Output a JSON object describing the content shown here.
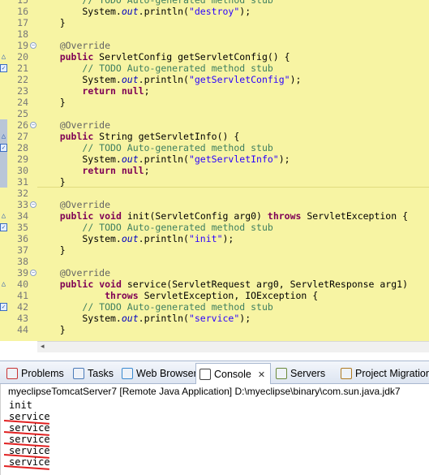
{
  "editor": {
    "lines": [
      {
        "num": "15",
        "tokens": [
          {
            "t": "        ",
            "c": ""
          },
          {
            "t": "// TODO Auto-generated method stub",
            "c": "cm"
          }
        ]
      },
      {
        "num": "16",
        "tokens": [
          {
            "t": "        System.",
            "c": ""
          },
          {
            "t": "out",
            "c": "it"
          },
          {
            "t": ".println(",
            "c": ""
          },
          {
            "t": "\"destroy\"",
            "c": "st"
          },
          {
            "t": ");",
            "c": ""
          }
        ]
      },
      {
        "num": "17",
        "tokens": [
          {
            "t": "    }",
            "c": ""
          }
        ]
      },
      {
        "num": "18",
        "tokens": []
      },
      {
        "num": "19",
        "fold": true,
        "tokens": [
          {
            "t": "    ",
            "c": ""
          },
          {
            "t": "@Override",
            "c": "ann"
          }
        ]
      },
      {
        "num": "20",
        "mark": "ovr",
        "tokens": [
          {
            "t": "    ",
            "c": ""
          },
          {
            "t": "public",
            "c": "kw"
          },
          {
            "t": " ServletConfig getServletConfig() {",
            "c": ""
          }
        ]
      },
      {
        "num": "21",
        "mark": "todo",
        "tokens": [
          {
            "t": "        ",
            "c": ""
          },
          {
            "t": "// TODO Auto-generated method stub",
            "c": "cm"
          }
        ]
      },
      {
        "num": "22",
        "tokens": [
          {
            "t": "        System.",
            "c": ""
          },
          {
            "t": "out",
            "c": "it"
          },
          {
            "t": ".println(",
            "c": ""
          },
          {
            "t": "\"getServletConfig\"",
            "c": "st"
          },
          {
            "t": ");",
            "c": ""
          }
        ]
      },
      {
        "num": "23",
        "tokens": [
          {
            "t": "        ",
            "c": ""
          },
          {
            "t": "return",
            "c": "kw"
          },
          {
            "t": " ",
            "c": ""
          },
          {
            "t": "null",
            "c": "kw"
          },
          {
            "t": ";",
            "c": ""
          }
        ]
      },
      {
        "num": "24",
        "tokens": [
          {
            "t": "    }",
            "c": ""
          }
        ]
      },
      {
        "num": "25",
        "tokens": []
      },
      {
        "num": "26",
        "fold": true,
        "band": true,
        "tokens": [
          {
            "t": "    ",
            "c": ""
          },
          {
            "t": "@Override",
            "c": "ann"
          }
        ]
      },
      {
        "num": "27",
        "mark": "ovr",
        "band": true,
        "tokens": [
          {
            "t": "    ",
            "c": ""
          },
          {
            "t": "public",
            "c": "kw"
          },
          {
            "t": " String getServletInfo() {",
            "c": ""
          }
        ]
      },
      {
        "num": "28",
        "mark": "todo",
        "band": true,
        "tokens": [
          {
            "t": "        ",
            "c": ""
          },
          {
            "t": "// TODO Auto-generated method stub",
            "c": "cm"
          }
        ]
      },
      {
        "num": "29",
        "band": true,
        "tokens": [
          {
            "t": "        System.",
            "c": ""
          },
          {
            "t": "out",
            "c": "it"
          },
          {
            "t": ".println(",
            "c": ""
          },
          {
            "t": "\"getServletInfo\"",
            "c": "st"
          },
          {
            "t": ");",
            "c": ""
          }
        ]
      },
      {
        "num": "30",
        "band": true,
        "tokens": [
          {
            "t": "        ",
            "c": ""
          },
          {
            "t": "return",
            "c": "kw"
          },
          {
            "t": " ",
            "c": ""
          },
          {
            "t": "null",
            "c": "kw"
          },
          {
            "t": ";",
            "c": ""
          }
        ]
      },
      {
        "num": "31",
        "band": true,
        "current": true,
        "tokens": [
          {
            "t": "    }",
            "c": ""
          }
        ]
      },
      {
        "num": "32",
        "tokens": []
      },
      {
        "num": "33",
        "fold": true,
        "tokens": [
          {
            "t": "    ",
            "c": ""
          },
          {
            "t": "@Override",
            "c": "ann"
          }
        ]
      },
      {
        "num": "34",
        "mark": "ovr",
        "tokens": [
          {
            "t": "    ",
            "c": ""
          },
          {
            "t": "public",
            "c": "kw"
          },
          {
            "t": " ",
            "c": ""
          },
          {
            "t": "void",
            "c": "kw"
          },
          {
            "t": " init(ServletConfig arg0) ",
            "c": ""
          },
          {
            "t": "throws",
            "c": "kw"
          },
          {
            "t": " ServletException {",
            "c": ""
          }
        ]
      },
      {
        "num": "35",
        "mark": "todo",
        "tokens": [
          {
            "t": "        ",
            "c": ""
          },
          {
            "t": "// TODO Auto-generated method stub",
            "c": "cm"
          }
        ]
      },
      {
        "num": "36",
        "tokens": [
          {
            "t": "        System.",
            "c": ""
          },
          {
            "t": "out",
            "c": "it"
          },
          {
            "t": ".println(",
            "c": ""
          },
          {
            "t": "\"init\"",
            "c": "st"
          },
          {
            "t": ");",
            "c": ""
          }
        ]
      },
      {
        "num": "37",
        "tokens": [
          {
            "t": "    }",
            "c": ""
          }
        ]
      },
      {
        "num": "38",
        "tokens": []
      },
      {
        "num": "39",
        "fold": true,
        "tokens": [
          {
            "t": "    ",
            "c": ""
          },
          {
            "t": "@Override",
            "c": "ann"
          }
        ]
      },
      {
        "num": "40",
        "mark": "ovr",
        "tokens": [
          {
            "t": "    ",
            "c": ""
          },
          {
            "t": "public",
            "c": "kw"
          },
          {
            "t": " ",
            "c": ""
          },
          {
            "t": "void",
            "c": "kw"
          },
          {
            "t": " service(ServletRequest arg0, ServletResponse arg1)",
            "c": ""
          }
        ]
      },
      {
        "num": "41",
        "tokens": [
          {
            "t": "            ",
            "c": ""
          },
          {
            "t": "throws",
            "c": "kw"
          },
          {
            "t": " ServletException, IOException {",
            "c": ""
          }
        ]
      },
      {
        "num": "42",
        "mark": "todo",
        "tokens": [
          {
            "t": "        ",
            "c": ""
          },
          {
            "t": "// TODO Auto-generated method stub",
            "c": "cm"
          }
        ]
      },
      {
        "num": "43",
        "tokens": [
          {
            "t": "        System.",
            "c": ""
          },
          {
            "t": "out",
            "c": "it"
          },
          {
            "t": ".println(",
            "c": ""
          },
          {
            "t": "\"service\"",
            "c": "st"
          },
          {
            "t": ");",
            "c": ""
          }
        ]
      },
      {
        "num": "44",
        "tokens": [
          {
            "t": "    }",
            "c": ""
          }
        ]
      }
    ]
  },
  "tabs": [
    {
      "label": "Problems",
      "icon": "problems-icon",
      "active": false
    },
    {
      "label": "Tasks",
      "icon": "tasks-icon",
      "active": false
    },
    {
      "label": "Web Browser",
      "icon": "globe-icon",
      "active": false
    },
    {
      "label": "Console",
      "icon": "console-icon",
      "active": true,
      "close": "✕"
    },
    {
      "label": "Servers",
      "icon": "servers-icon",
      "active": false
    },
    {
      "label": "Project Migration",
      "icon": "migration-icon",
      "active": false
    }
  ],
  "console": {
    "title": "myeclipseTomcatServer7 [Remote Java Application] D:\\myeclipse\\binary\\com.sun.java.jdk7",
    "output": [
      "init",
      "service",
      "service",
      "service",
      "service",
      "service"
    ]
  },
  "colors": {
    "editor_bg": "#f7f4a3",
    "keyword": "#7f0055",
    "comment": "#3f7f5f",
    "string": "#2a00ff",
    "annotation_red": "#e02020"
  }
}
